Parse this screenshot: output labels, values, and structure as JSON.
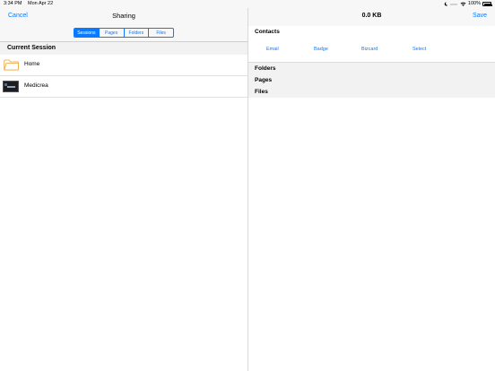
{
  "status_bar": {
    "time": "3:34 PM",
    "date": "Mon Apr 22",
    "battery": "100%"
  },
  "left": {
    "title": "Sharing",
    "cancel_label": "Cancel",
    "segments": [
      "Sessions",
      "Pages",
      "Folders",
      "Files"
    ],
    "active_segment": "Sessions",
    "section_title": "Current Session",
    "items": [
      {
        "label": "Home",
        "icon": "folder-icon"
      },
      {
        "label": "Medicrea",
        "icon": "session-thumbnail"
      }
    ]
  },
  "right": {
    "title": "0.0 KB",
    "save_label": "Save",
    "contacts_title": "Contacts",
    "contact_actions": [
      "Email",
      "Badge",
      "Bizcard",
      "Select"
    ],
    "sections": [
      "Folders",
      "Pages",
      "Files"
    ]
  },
  "colors": {
    "accent": "#0a7aff",
    "folder": "#f0a030",
    "header_bg": "#f7f7f7"
  }
}
